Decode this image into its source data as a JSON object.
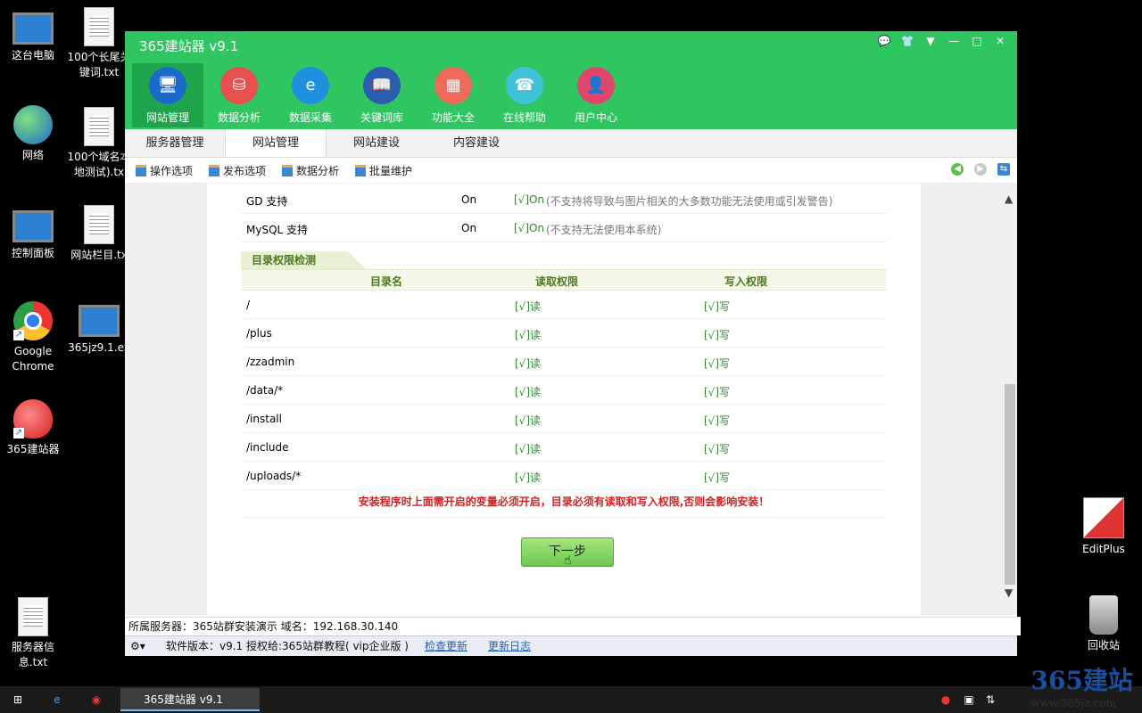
{
  "desktop": {
    "icons_left": [
      {
        "label": "这台电脑",
        "kind": "monitor"
      },
      {
        "label": "网络",
        "kind": "globe"
      },
      {
        "label": "控制面板",
        "kind": "monitor"
      },
      {
        "label": "Google Chrome",
        "kind": "chrome"
      },
      {
        "label": "365建站器",
        "kind": "apple"
      },
      {
        "label": "服务器信息.txt",
        "kind": "doc"
      }
    ],
    "icons_col2": [
      {
        "label": "100个长尾关键词.txt"
      },
      {
        "label": "100个域名本地测试).tx"
      },
      {
        "label": "网站栏目.tx"
      },
      {
        "label": "365jz9.1.ex"
      }
    ],
    "icons_right": [
      {
        "label": "EditPlus"
      },
      {
        "label": "回收站"
      }
    ]
  },
  "app": {
    "title": "365建站器 v9.1",
    "window_controls": [
      "💬",
      "👕",
      "▼",
      "—",
      "□",
      "✕"
    ],
    "nav": [
      {
        "label": "网站管理",
        "color": "#1a6bc9",
        "glyph": "🖥"
      },
      {
        "label": "数据分析",
        "color": "#e84f4f",
        "glyph": "⛁"
      },
      {
        "label": "数据采集",
        "color": "#1f8fe0",
        "glyph": "e"
      },
      {
        "label": "关键词库",
        "color": "#2a5db0",
        "glyph": "📖"
      },
      {
        "label": "功能大全",
        "color": "#ef6b5b",
        "glyph": "▦"
      },
      {
        "label": "在线帮助",
        "color": "#3fc2d8",
        "glyph": "☎"
      },
      {
        "label": "用户中心",
        "color": "#e0466b",
        "glyph": "👤"
      }
    ],
    "tabs": [
      "服务器管理",
      "网站管理",
      "网站建设",
      "内容建设"
    ],
    "toolbar": [
      "操作选项",
      "发布选项",
      "数据分析",
      "批量维护"
    ],
    "top_rows": [
      {
        "name": "GD 支持",
        "value": "On",
        "status": "[√]On",
        "note": "(不支持将导致与图片相关的大多数功能无法使用或引发警告)"
      },
      {
        "name": "MySQL 支持",
        "value": "On",
        "status": "[√]On",
        "note": "(不支持无法使用本系统)"
      }
    ],
    "section_title": "目录权限检测",
    "table_headers": {
      "dir": "目录名",
      "read": "读取权限",
      "write": "写入权限"
    },
    "dirs": [
      {
        "dir": "/",
        "read": "[√]读",
        "write": "[√]写"
      },
      {
        "dir": "/plus",
        "read": "[√]读",
        "write": "[√]写"
      },
      {
        "dir": "/zzadmin",
        "read": "[√]读",
        "write": "[√]写"
      },
      {
        "dir": "/data/*",
        "read": "[√]读",
        "write": "[√]写"
      },
      {
        "dir": "/install",
        "read": "[√]读",
        "write": "[√]写"
      },
      {
        "dir": "/include",
        "read": "[√]读",
        "write": "[√]写"
      },
      {
        "dir": "/uploads/*",
        "read": "[√]读",
        "write": "[√]写"
      }
    ],
    "warning": "安装程序时上面需开启的变量必须开启，目录必须有读取和写入权限,否则会影响安装！",
    "next_button": "下一步",
    "status_server": "所属服务器：365站群安装演示 域名：192.168.30.140",
    "status_version": "软件版本：v9.1",
    "status_license": "授权给:365站群教程( vip企业版 )",
    "check_update": "检查更新",
    "update_log": "更新日志"
  },
  "taskbar": {
    "app_label": "365建站器 v9.1",
    "watermark_top": "365建站",
    "watermark_url": "www.365jz.com"
  }
}
